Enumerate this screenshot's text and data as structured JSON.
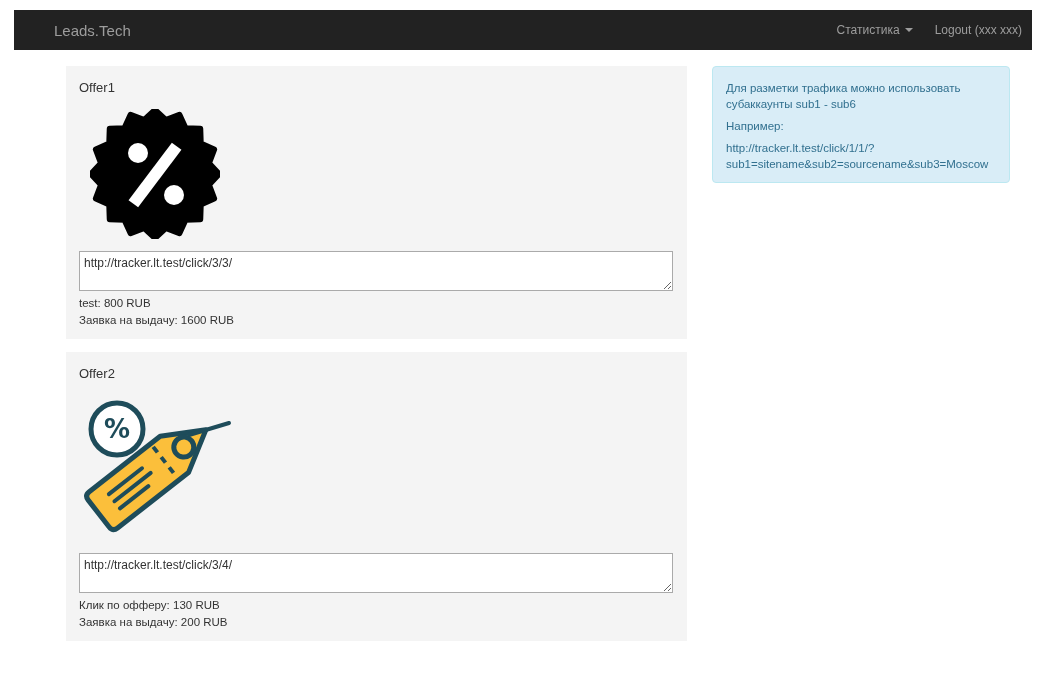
{
  "navbar": {
    "brand": "Leads.Tech",
    "menu": [
      {
        "label": "Статистика",
        "dropdown": true
      },
      {
        "label": "Logout (xxx xxx)",
        "dropdown": false
      }
    ]
  },
  "offers": [
    {
      "title": "Offer1",
      "kind": "badge",
      "url": "http://tracker.lt.test/click/3/3/",
      "lines": [
        "test: 800 RUB",
        "Заявка на выдачу: 1600 RUB"
      ]
    },
    {
      "title": "Offer2",
      "kind": "tag",
      "icon_text": "%",
      "url": "http://tracker.lt.test/click/3/4/",
      "lines": [
        "Клик по офферу: 130 RUB",
        "Заявка на выдачу: 200 RUB"
      ]
    }
  ],
  "info": {
    "lines": [
      "Для разметки трафика можно использовать субаккаунты sub1 - sub6",
      "Например:",
      "http://tracker.lt.test/click/1/1/?sub1=sitename&sub2=sourcename&sub3=Moscow"
    ]
  }
}
